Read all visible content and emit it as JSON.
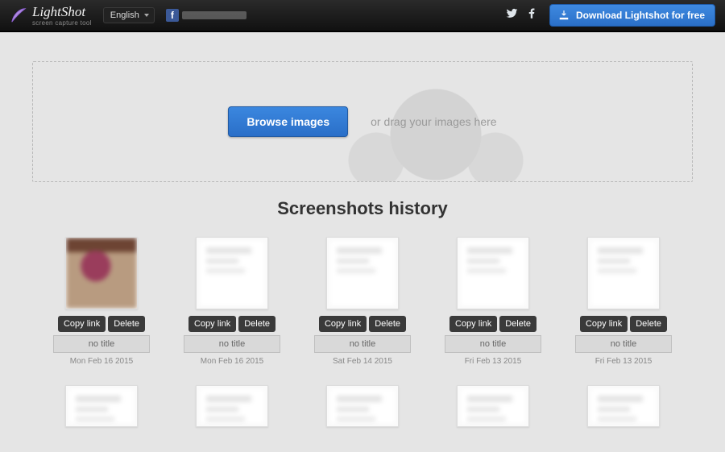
{
  "header": {
    "brand": "LightShot",
    "tagline": "screen capture tool",
    "language": "English",
    "download_label": "Download Lightshot for free"
  },
  "dropzone": {
    "browse_label": "Browse images",
    "hint": "or drag your images here"
  },
  "history": {
    "title": "Screenshots history",
    "copy_label": "Copy link",
    "delete_label": "Delete",
    "items": [
      {
        "title": "no title",
        "date": "Mon Feb 16 2015"
      },
      {
        "title": "no title",
        "date": "Mon Feb 16 2015"
      },
      {
        "title": "no title",
        "date": "Sat Feb 14 2015"
      },
      {
        "title": "no title",
        "date": "Fri Feb 13 2015"
      },
      {
        "title": "no title",
        "date": "Fri Feb 13 2015"
      }
    ]
  }
}
